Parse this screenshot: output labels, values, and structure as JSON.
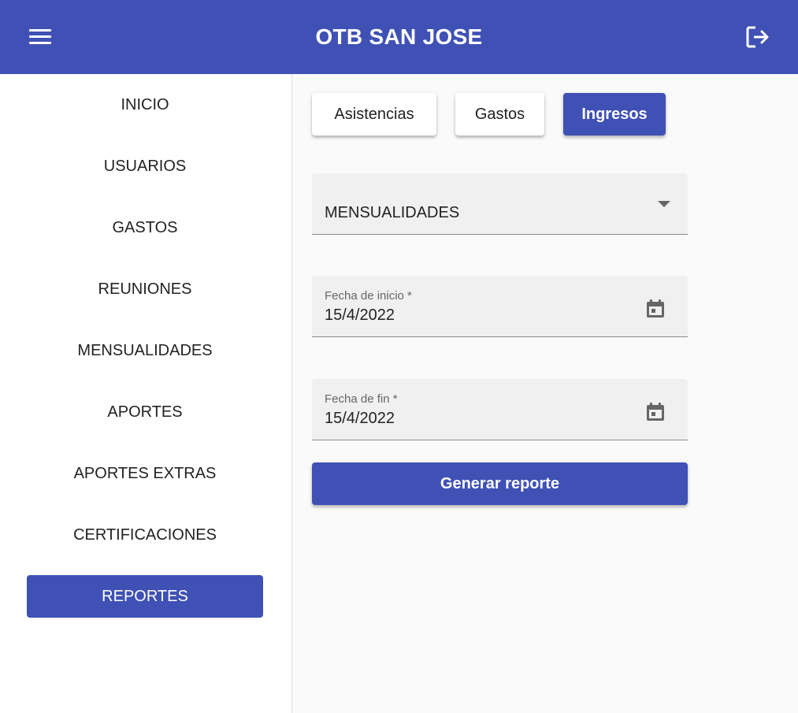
{
  "header": {
    "title": "OTB SAN JOSE",
    "menu_icon": "hamburger-icon",
    "logout_icon": "logout-icon",
    "color": "#3f51b5"
  },
  "sidebar": {
    "items": [
      {
        "label": "INICIO"
      },
      {
        "label": "USUARIOS"
      },
      {
        "label": "GASTOS"
      },
      {
        "label": "REUNIONES"
      },
      {
        "label": "MENSUALIDADES"
      },
      {
        "label": "APORTES"
      },
      {
        "label": "APORTES EXTRAS"
      },
      {
        "label": "CERTIFICACIONES"
      },
      {
        "label": "REPORTES",
        "active": true
      }
    ]
  },
  "main": {
    "tabs": [
      {
        "label": "Asistencias"
      },
      {
        "label": "Gastos"
      },
      {
        "label": "Ingresos",
        "active": true
      }
    ],
    "type_select": {
      "value": "MENSUALIDADES"
    },
    "start_date": {
      "label": "Fecha de inicio *",
      "value": "15/4/2022"
    },
    "end_date": {
      "label": "Fecha de fin *",
      "value": "15/4/2022"
    },
    "generate_label": "Generar reporte"
  }
}
